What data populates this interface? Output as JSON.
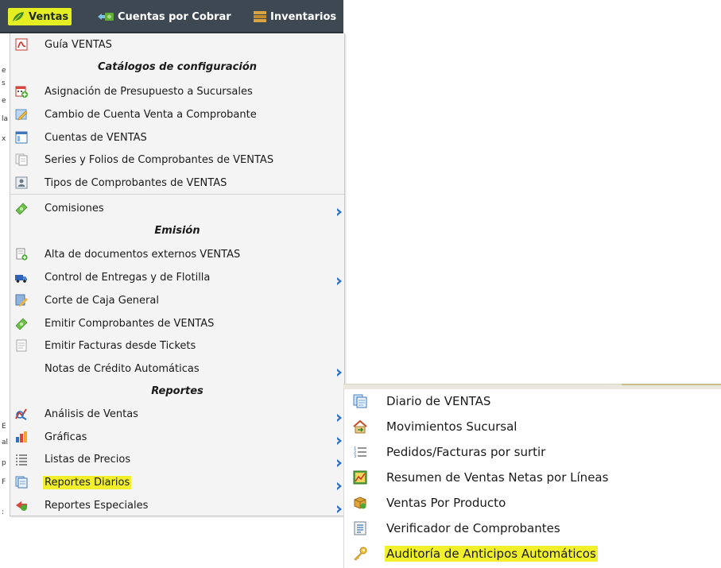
{
  "topbar": {
    "items": [
      {
        "label": "Ventas",
        "icon": "leaf-icon",
        "active": true
      },
      {
        "label": "Cuentas por Cobrar",
        "icon": "money-arrow-icon",
        "active": false
      },
      {
        "label": "Inventarios",
        "icon": "boxes-icon",
        "active": false
      }
    ]
  },
  "left_edge_fragments": [
    "e",
    "s",
    "e",
    "la",
    "x",
    "E",
    "al",
    "p",
    "F",
    ":"
  ],
  "menu": {
    "items": [
      {
        "label": "Guía VENTAS",
        "icon": "pdf-icon"
      },
      {
        "header": "Catálogos de configuración"
      },
      {
        "label": "Asignación de Presupuesto a Sucursales",
        "icon": "calendar-plus-icon"
      },
      {
        "label": "Cambio de Cuenta Venta a Comprobante",
        "icon": "edit-document-icon"
      },
      {
        "label": "Cuentas de VENTAS",
        "icon": "window-icon"
      },
      {
        "label": "Series y Folios de Comprobantes de VENTAS",
        "icon": "documents-icon"
      },
      {
        "label": "Tipos de Comprobantes de VENTAS",
        "icon": "id-card-icon"
      },
      {
        "label": "Comisiones",
        "icon": "money-icon",
        "submenu": true
      },
      {
        "header": "Emisión"
      },
      {
        "label": "Alta de documentos externos VENTAS",
        "icon": "document-add-icon"
      },
      {
        "label": "Control de Entregas y de Flotilla",
        "icon": "truck-icon",
        "submenu": true
      },
      {
        "label": "Corte de Caja General",
        "icon": "pencil-document-icon"
      },
      {
        "label": "Emitir Comprobantes de VENTAS",
        "icon": "cash-icon"
      },
      {
        "label": "Emitir Facturas desde Tickets",
        "icon": "receipt-icon"
      },
      {
        "label": "Notas de Crédito Automáticas",
        "icon": "",
        "submenu": true
      },
      {
        "header": "Reportes"
      },
      {
        "label": "Análisis de Ventas",
        "icon": "analysis-icon",
        "submenu": true
      },
      {
        "label": "Gráficas",
        "icon": "bar-chart-icon",
        "submenu": true
      },
      {
        "label": "Listas de Precios",
        "icon": "list-icon",
        "submenu": true
      },
      {
        "label": "Reportes Diarios",
        "icon": "daily-report-icon",
        "submenu": true,
        "highlighted": true
      },
      {
        "label": "Reportes Especiales",
        "icon": "special-report-icon",
        "submenu": true
      }
    ]
  },
  "submenu": {
    "items": [
      {
        "label": "Diario de VENTAS",
        "icon": "daily-report-icon"
      },
      {
        "label": "Movimientos Sucursal",
        "icon": "branch-house-icon"
      },
      {
        "label": "Pedidos/Facturas por surtir",
        "icon": "numbered-list-icon"
      },
      {
        "label": "Resumen de Ventas Netas por Líneas",
        "icon": "line-chart-icon"
      },
      {
        "label": "Ventas Por Producto",
        "icon": "product-box-icon"
      },
      {
        "label": "Verificador de Comprobantes",
        "icon": "checklist-icon"
      },
      {
        "label": "Auditoría de Anticipos Automáticos",
        "icon": "key-icon",
        "highlighted": true
      }
    ]
  },
  "colors": {
    "topbar": "#3d4852",
    "highlight": "#f1f02b",
    "menu_bg": "#f4f4f4",
    "arrow": "#2f6fc4"
  }
}
